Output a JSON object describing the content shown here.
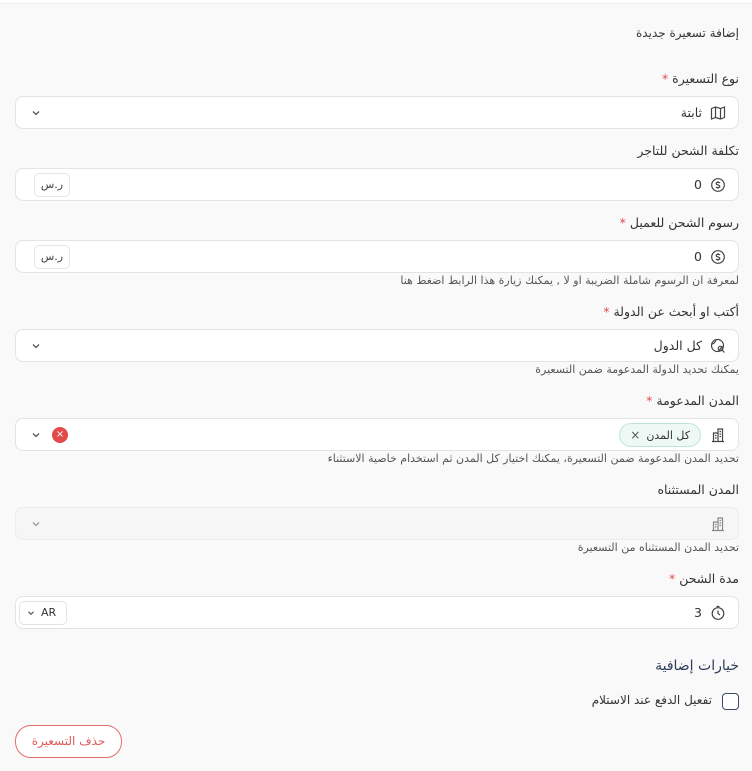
{
  "form": {
    "title": "إضافة تسعيرة جديدة",
    "pricing_type": {
      "label": "نوع التسعيرة",
      "required_mark": "*",
      "value": "ثابتة"
    },
    "merchant_shipping_cost": {
      "label": "تكلفة الشحن للتاجر",
      "value": "0",
      "unit": "ر.س"
    },
    "customer_shipping_fee": {
      "label": "رسوم الشحن للعميل",
      "required_mark": "*",
      "value": "0",
      "unit": "ر.س",
      "help": "لمعرفة ان الرسوم شاملة الضريبة او لا , يمكنك زيارة هذا الرابط اضغط هنا"
    },
    "country": {
      "label": "أكتب او أبحث عن الدولة",
      "required_mark": "*",
      "value": "كل الدول",
      "help": "يمكنك تحديد الدولة المدعومة ضمن التسعيرة"
    },
    "supported_cities": {
      "label": "المدن المدعومة",
      "required_mark": "*",
      "chip": "كل المدن",
      "chip_remove": "×",
      "clear": "×",
      "help": "تحديد المدن المدعومة ضمن التسعيرة، يمكنك اختيار كل المدن ثم استخدام خاصية الاستثناء"
    },
    "excluded_cities": {
      "label": "المدن المستثناه",
      "help": "تحديد المدن المستثناه من التسعيرة"
    },
    "shipping_duration": {
      "label": "مدة الشحن",
      "required_mark": "*",
      "value": "3",
      "lang": "AR"
    },
    "extra_options": {
      "title": "خيارات إضافية",
      "cod_label": "تفعيل الدفع عند الاستلام"
    },
    "delete_button": "حذف التسعيرة"
  },
  "icons": {
    "pricing_type": "map-icon",
    "cost": "coin-icon",
    "country": "globe-search-icon",
    "city": "building-icon",
    "duration": "timer-icon",
    "dropdown": "chevron-down-icon"
  },
  "colors": {
    "required": "#e24b4b",
    "chip_bg": "#eef9f5",
    "danger": "#e15a5a",
    "section_title": "#2d3e5a"
  }
}
